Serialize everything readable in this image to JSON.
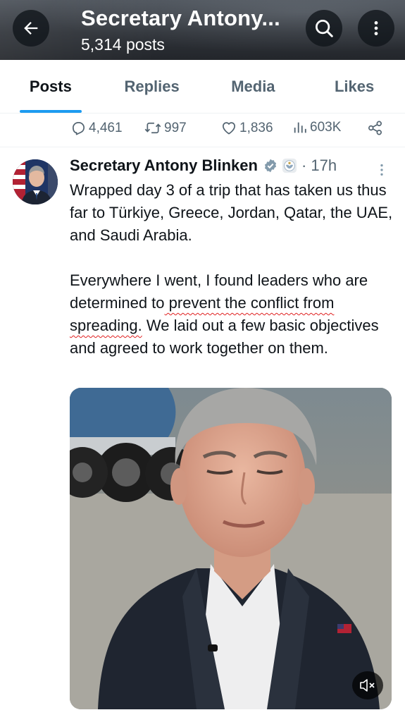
{
  "header": {
    "title": "Secretary Antony...",
    "subtitle": "5,314 posts"
  },
  "tabs": [
    {
      "label": "Posts",
      "active": true
    },
    {
      "label": "Replies",
      "active": false
    },
    {
      "label": "Media",
      "active": false
    },
    {
      "label": "Likes",
      "active": false
    }
  ],
  "prev_actions": {
    "replies": "4,461",
    "reposts": "997",
    "likes": "1,836",
    "views": "603K"
  },
  "tweet": {
    "author": "Secretary Antony Blinken",
    "time": "17h",
    "separator": "·",
    "paragraph1": "Wrapped day 3 of a trip that has taken us thus far to Türkiye, Greece, Jordan, Qatar, the UAE, and Saudi Arabia.",
    "p2_before": "Everywhere I went, I found leaders who are determined to",
    "p2_underlined": " prevent the conflict from spreading.",
    "p2_after": " We laid out a few basic objectives and agreed to work together on them."
  },
  "icons": {
    "back": "arrow-left-icon",
    "search": "search-icon",
    "more": "more-vertical-icon",
    "reply": "reply-icon",
    "repost": "repost-icon",
    "like": "heart-icon",
    "views": "views-icon",
    "share": "share-icon",
    "verified": "verified-badge-icon",
    "mute": "mute-icon"
  },
  "colors": {
    "accent": "#1d9bf0",
    "text": "#0f1419",
    "muted": "#536471",
    "verified_gray": "#829aab",
    "spell_underline": "#e02020"
  }
}
